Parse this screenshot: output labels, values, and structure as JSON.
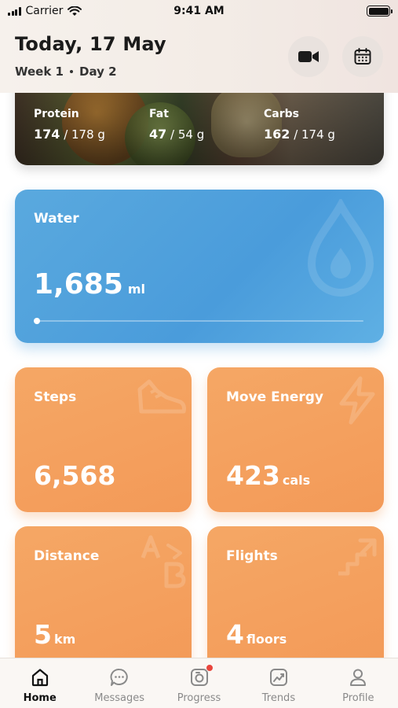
{
  "status_bar": {
    "carrier": "Carrier",
    "time": "9:41 AM"
  },
  "header": {
    "title": "Today, 17 May",
    "week": "Week 1",
    "day": "Day 2"
  },
  "nutrition": {
    "macros": [
      {
        "label": "Protein",
        "consumed": "174",
        "target": "/ 178 g"
      },
      {
        "label": "Fat",
        "consumed": "47",
        "target": "/ 54 g"
      },
      {
        "label": "Carbs",
        "consumed": "162",
        "target": "/ 174 g"
      }
    ]
  },
  "water": {
    "label": "Water",
    "value": "1,685",
    "unit": "ml",
    "progress_fraction": 0.0
  },
  "stats": {
    "steps": {
      "label": "Steps",
      "value": "6,568",
      "unit": ""
    },
    "move_energy": {
      "label": "Move Energy",
      "value": "423",
      "unit": "cals"
    },
    "distance": {
      "label": "Distance",
      "value": "5",
      "unit": "km"
    },
    "flights": {
      "label": "Flights",
      "value": "4",
      "unit": "floors"
    }
  },
  "tabs": [
    {
      "label": "Home",
      "icon": "home-icon",
      "active": true
    },
    {
      "label": "Messages",
      "icon": "messages-icon",
      "active": false
    },
    {
      "label": "Progress",
      "icon": "progress-icon",
      "active": false,
      "badge": true
    },
    {
      "label": "Trends",
      "icon": "trends-icon",
      "active": false
    },
    {
      "label": "Profile",
      "icon": "profile-icon",
      "active": false
    }
  ],
  "colors": {
    "water_card": "#4a9cdb",
    "stat_card": "#f39a58",
    "badge": "#e8453c"
  }
}
